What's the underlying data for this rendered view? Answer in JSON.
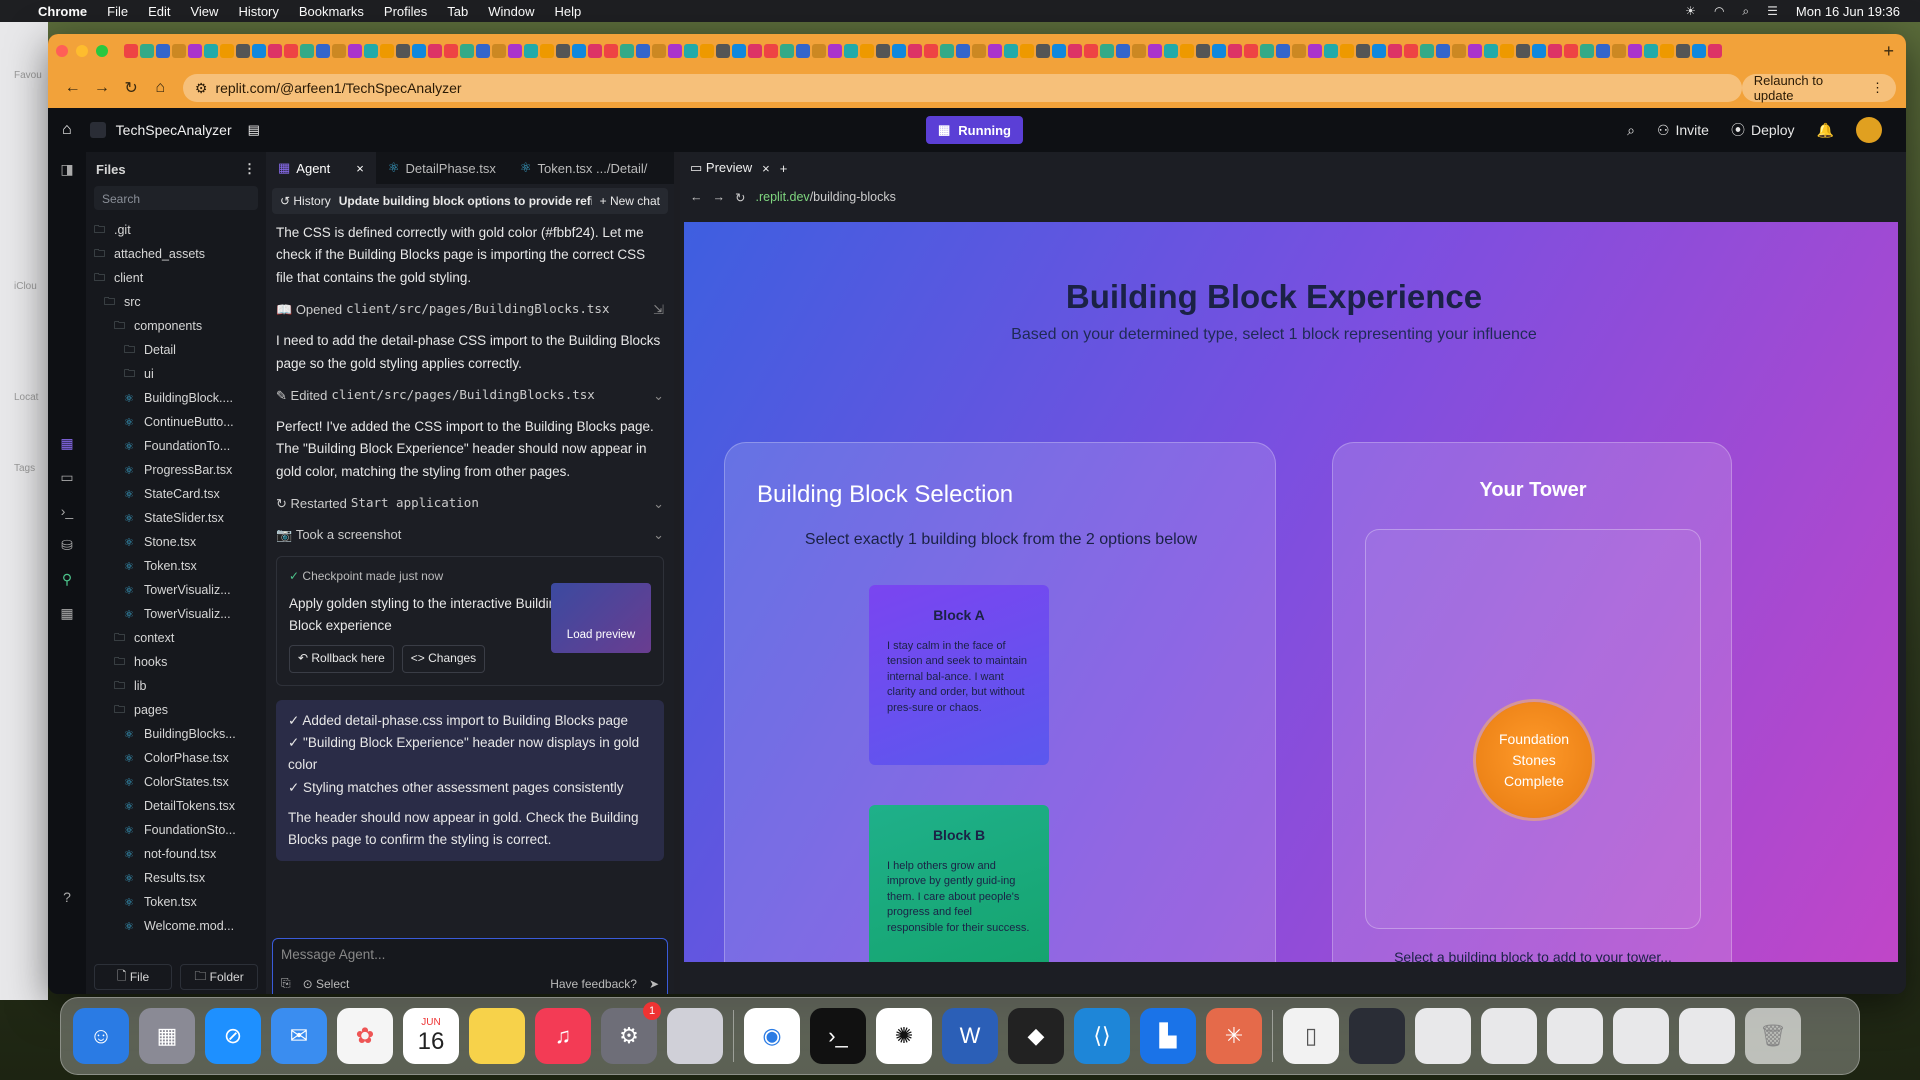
{
  "menubar": {
    "app": "Chrome",
    "items": [
      "File",
      "Edit",
      "View",
      "History",
      "Bookmarks",
      "Profiles",
      "Tab",
      "Window",
      "Help"
    ],
    "clock": "Mon 16 Jun  19:36"
  },
  "finder_peek": [
    "Favou",
    "iClou",
    "Locat",
    "Tags"
  ],
  "browser": {
    "url": "replit.com/@arfeen1/TechSpecAnalyzer",
    "relaunch_label": "Relaunch to update"
  },
  "replit": {
    "project": "TechSpecAnalyzer",
    "status": "Running",
    "invite": "Invite",
    "deploy": "Deploy"
  },
  "files": {
    "title": "Files",
    "search_placeholder": "Search",
    "items": [
      {
        "name": ".git",
        "type": "folder",
        "depth": 0
      },
      {
        "name": "attached_assets",
        "type": "folder",
        "depth": 0
      },
      {
        "name": "client",
        "type": "folder",
        "depth": 0
      },
      {
        "name": "src",
        "type": "folder",
        "depth": 1
      },
      {
        "name": "components",
        "type": "folder",
        "depth": 2
      },
      {
        "name": "Detail",
        "type": "folder",
        "depth": 3
      },
      {
        "name": "ui",
        "type": "folder",
        "depth": 3
      },
      {
        "name": "BuildingBlock....",
        "type": "file",
        "depth": 3
      },
      {
        "name": "ContinueButto...",
        "type": "file",
        "depth": 3
      },
      {
        "name": "FoundationTo...",
        "type": "file",
        "depth": 3
      },
      {
        "name": "ProgressBar.tsx",
        "type": "file",
        "depth": 3
      },
      {
        "name": "StateCard.tsx",
        "type": "file",
        "depth": 3
      },
      {
        "name": "StateSlider.tsx",
        "type": "file",
        "depth": 3
      },
      {
        "name": "Stone.tsx",
        "type": "file",
        "depth": 3
      },
      {
        "name": "Token.tsx",
        "type": "file",
        "depth": 3
      },
      {
        "name": "TowerVisualiz...",
        "type": "file",
        "depth": 3
      },
      {
        "name": "TowerVisualiz...",
        "type": "file",
        "depth": 3
      },
      {
        "name": "context",
        "type": "folder",
        "depth": 2
      },
      {
        "name": "hooks",
        "type": "folder",
        "depth": 2
      },
      {
        "name": "lib",
        "type": "folder",
        "depth": 2
      },
      {
        "name": "pages",
        "type": "folder",
        "depth": 2
      },
      {
        "name": "BuildingBlocks...",
        "type": "file",
        "depth": 3
      },
      {
        "name": "ColorPhase.tsx",
        "type": "file",
        "depth": 3
      },
      {
        "name": "ColorStates.tsx",
        "type": "file",
        "depth": 3
      },
      {
        "name": "DetailTokens.tsx",
        "type": "file",
        "depth": 3
      },
      {
        "name": "FoundationSto...",
        "type": "file",
        "depth": 3
      },
      {
        "name": "not-found.tsx",
        "type": "file",
        "depth": 3
      },
      {
        "name": "Results.tsx",
        "type": "file",
        "depth": 3
      },
      {
        "name": "Token.tsx",
        "type": "file",
        "depth": 3
      },
      {
        "name": "Welcome.mod...",
        "type": "file",
        "depth": 3
      }
    ],
    "new_file": "File",
    "new_folder": "Folder"
  },
  "agent": {
    "tabs": [
      "Agent",
      "DetailPhase.tsx",
      "Token.tsx  .../Detail/"
    ],
    "history_label": "History",
    "thread_title": "Update building block options to provide refined pers...",
    "new_chat": "New chat",
    "msg1": "The CSS is defined correctly with gold color (#fbbf24). Let me check if the Building Blocks page is importing the correct CSS file that contains the gold styling.",
    "act1_verb": "Opened",
    "act1_path": "client/src/pages/BuildingBlocks.tsx",
    "msg2": "I need to add the detail-phase CSS import to the Building Blocks page so the gold styling applies correctly.",
    "act2_verb": "Edited",
    "act2_path": "client/src/pages/BuildingBlocks.tsx",
    "msg3": "Perfect! I've added the CSS import to the Building Blocks page. The \"Building Block Experience\" header should now appear in gold color, matching the styling from other pages.",
    "act3_verb": "Restarted",
    "act3_path": "Start application",
    "act4": "Took a screenshot",
    "checkpoint_time": "Checkpoint made just now",
    "checkpoint_desc": "Apply golden styling to the interactive Building Block experience",
    "rollback": "Rollback here",
    "changes": "Changes",
    "load_preview": "Load preview",
    "summary_items": [
      "✓ Added detail-phase.css import to Building Blocks page",
      "✓ \"Building Block Experience\" header now displays in gold color",
      "✓ Styling matches other assessment pages consistently"
    ],
    "summary_footer": "The header should now appear in gold. Check the Building Blocks page to confirm the styling is correct.",
    "input_placeholder": "Message Agent...",
    "select_label": "Select",
    "feedback": "Have feedback?"
  },
  "preview": {
    "tab": "Preview",
    "url_domain": ".replit.dev",
    "url_path": "/building-blocks",
    "title": "Building Block Experience",
    "subtitle": "Based on your determined type, select 1 block representing your influence",
    "selection_title": "Building Block Selection",
    "selection_hint": "Select exactly 1 building block from the 2 options below",
    "block_a_title": "Block A",
    "block_a_text": "I stay calm in the face of tension and seek to maintain internal bal-ance. I want clarity and order, but without pres-sure or chaos.",
    "block_b_title": "Block B",
    "block_b_text": "I help others grow and improve by gently guid-ing them. I care about people's progress and feel responsible for their success.",
    "tower_title": "Your Tower",
    "stone_label_1": "Foundation",
    "stone_label_2": "Stones",
    "stone_label_3": "Complete",
    "tower_footer": "Select a building block to add to your tower..."
  },
  "dock_calendar": {
    "month": "JUN",
    "day": "16"
  },
  "dock_badge": "1"
}
